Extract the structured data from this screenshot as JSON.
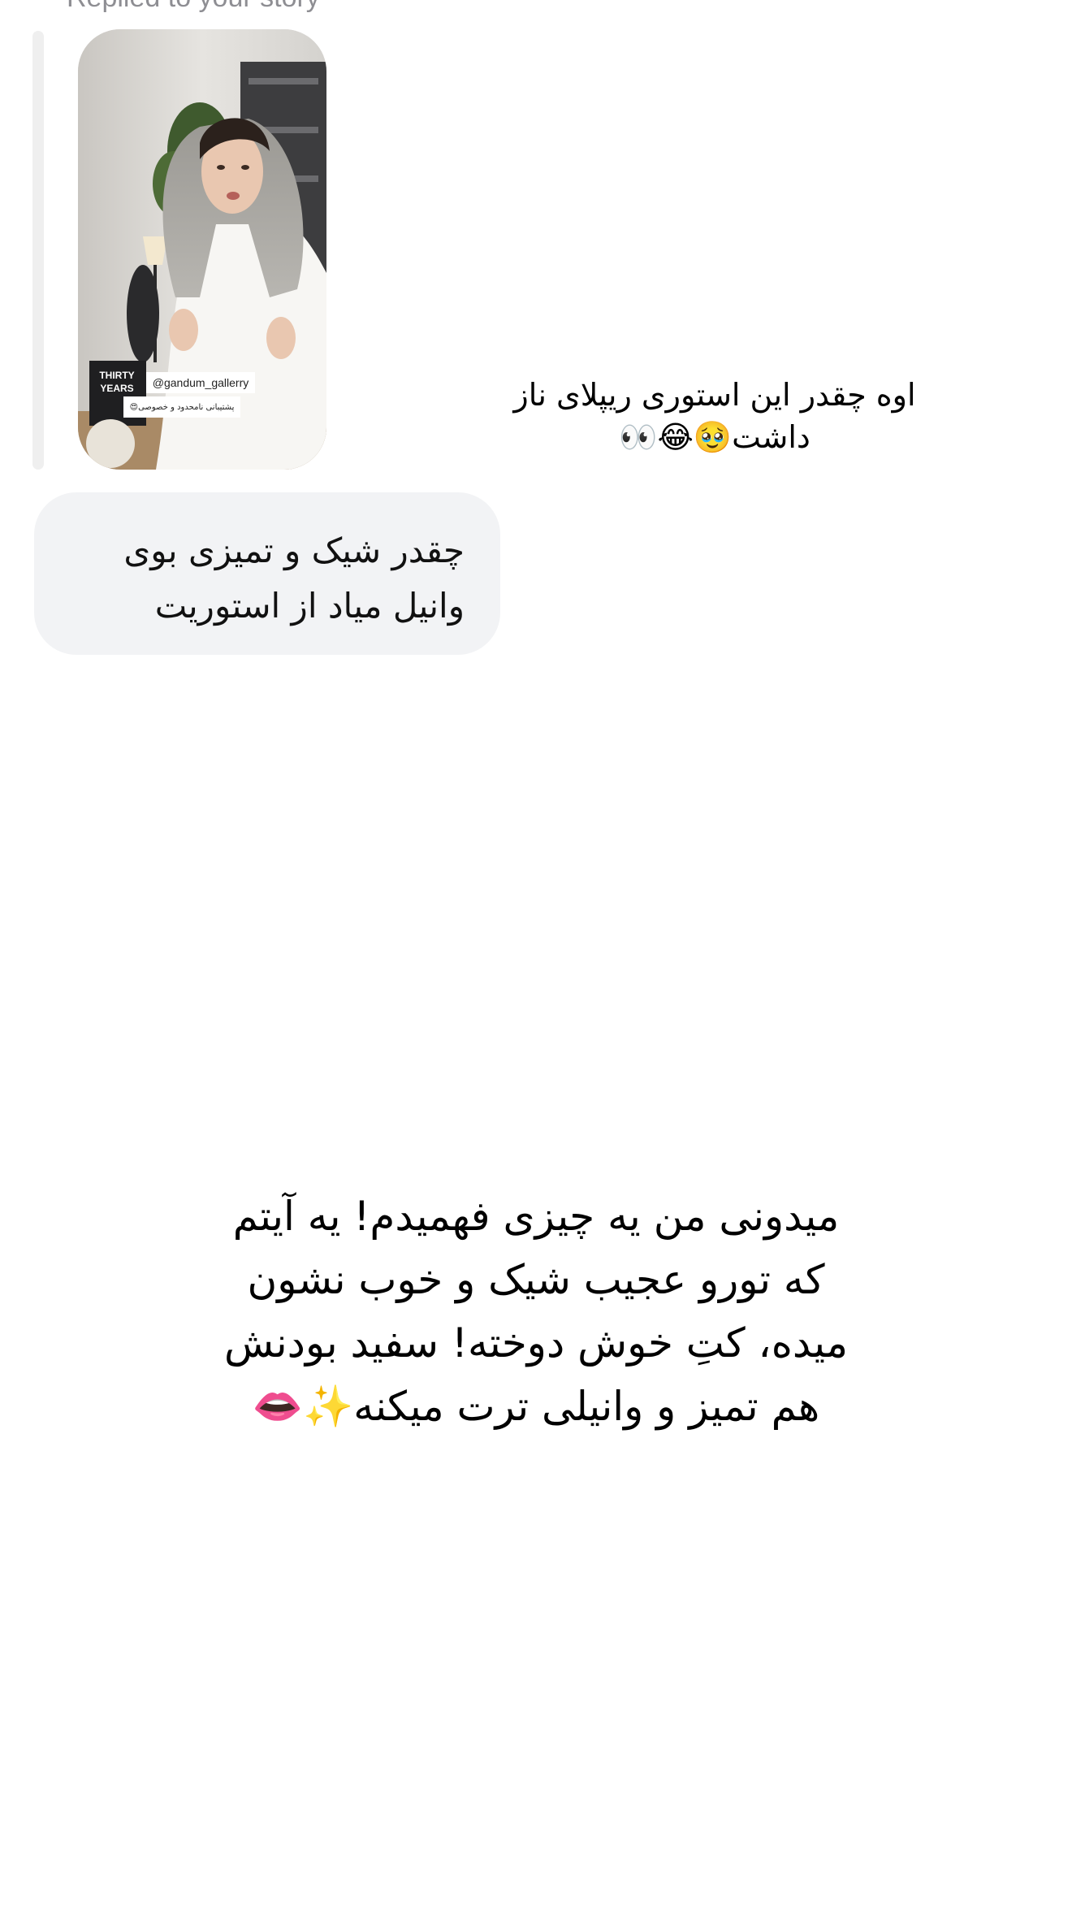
{
  "thread": {
    "replied_label": "Replied to your story",
    "story_thumbnail": {
      "handle_sticker": "@gandum_gallerry",
      "caption_sticker": "پشتیبانی نامحدود و خصوصی😍",
      "book_cover": "THIRTY YEARS"
    },
    "reply_message": "اوه چقدر این استوری ریپلای ناز داشت🥹😂👀",
    "incoming_message": "چقدر شیک و تمیزی بوی وانیل میاد از استوریت"
  },
  "story": {
    "text": "میدونی من یه چیزی فهمیدم! یه آیتم که تورو عجیب شیک و خوب نشون میده، کتِ خوش دوخته! سفید بودنش هم تمیز و وانیلی ترت میکنه✨👄"
  }
}
